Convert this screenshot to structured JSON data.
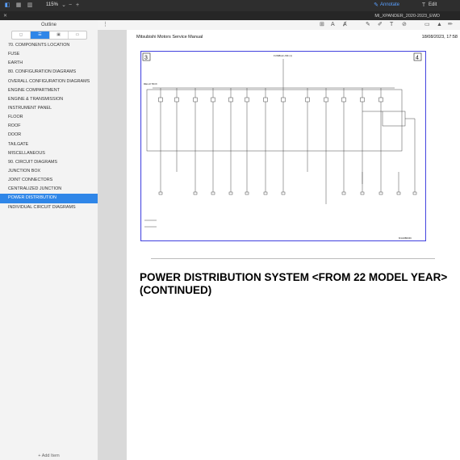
{
  "app": {
    "zoom": "115%",
    "annotate_label": "Annotate",
    "edit_label": "Edit",
    "file_name": "MI_XPANDER_2020-2023_EWD"
  },
  "sidebar": {
    "title": "Outline",
    "add_item_label": "+ Add Item",
    "items": [
      "70. COMPONENTS LOCATION",
      "FUSE",
      "EARTH",
      "80. CONFIGURATION DIAGRAMS",
      "OVERALL CONFIGURATION DIAGRAMS",
      "ENGINE COMPARTMENT",
      "ENGINE & TRANSMISSION",
      "INSTRUMENT PANEL",
      "FLOOR",
      "ROOF",
      "DOOR",
      "TAILGATE",
      "MISCELLANEOUS",
      "90. CIRCUIT DIAGRAMS",
      "JUNCTION BOX",
      "JOINT CONNECTORS",
      "CENTRALIZED JUNCTION",
      "POWER DISTRIBUTION",
      "INDIVIDUAL CIRCUIT DIAGRAMS"
    ],
    "selected_index": 17
  },
  "page": {
    "header_left": "Mitsubishi Motors Service Manual",
    "header_right": "18/08/2023, 17:58",
    "heading": "POWER DISTRIBUTION SYSTEM <FROM 22 MODEL YEAR> (CONTINUED)",
    "diagram": {
      "corner_left": "3",
      "corner_right": "4",
      "relay_box_label": "RELAY BOX",
      "top_label": "FUSIBLE LINK (1)",
      "code_bottom_right": "M1ADB0046",
      "accent": "#4a4ae0"
    }
  }
}
